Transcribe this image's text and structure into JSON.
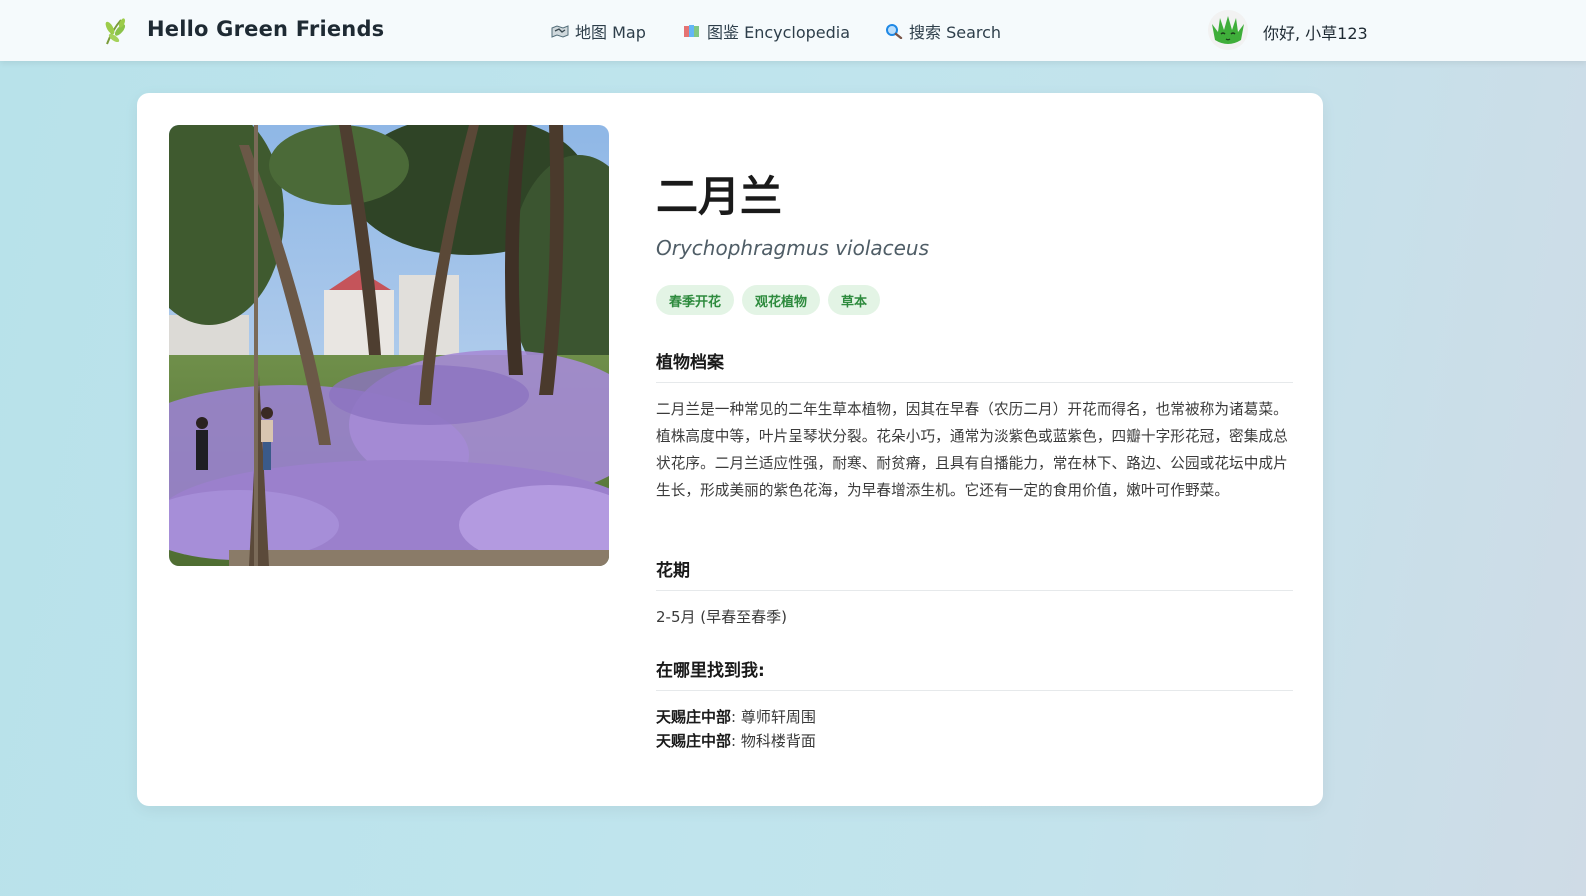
{
  "header": {
    "brand": "Hello Green Friends",
    "nav": [
      {
        "label": "地图 Map",
        "icon": "map-icon"
      },
      {
        "label": "图鉴 Encyclopedia",
        "icon": "books-icon"
      },
      {
        "label": "搜索 Search",
        "icon": "magnifier-icon"
      }
    ],
    "greeting": "你好, 小草123"
  },
  "plant": {
    "name": "二月兰",
    "scientific_name": "Orychophragmus violaceus",
    "tags": [
      "春季开花",
      "观花植物",
      "草本"
    ],
    "profile_heading": "植物档案",
    "description": "二月兰是一种常见的二年生草本植物，因其在早春（农历二月）开花而得名，也常被称为诸葛菜。植株高度中等，叶片呈琴状分裂。花朵小巧，通常为淡紫色或蓝紫色，四瓣十字形花冠，密集成总状花序。二月兰适应性强，耐寒、耐贫瘠，且具有自播能力，常在林下、路边、公园或花坛中成片生长，形成美丽的紫色花海，为早春增添生机。它还有一定的食用价值，嫩叶可作野菜。",
    "bloom_heading": "花期",
    "bloom_period": "2-5月 (早春至春季)",
    "locations_heading": "在哪里找到我:",
    "locations": [
      {
        "area": "天赐庄中部",
        "spot": "尊师轩周围"
      },
      {
        "area": "天赐庄中部",
        "spot": "物科楼背面"
      }
    ]
  },
  "colors": {
    "tag_bg": "#e3f4e5",
    "tag_text": "#2e8b3e",
    "flowers": "#9b7fd0"
  }
}
